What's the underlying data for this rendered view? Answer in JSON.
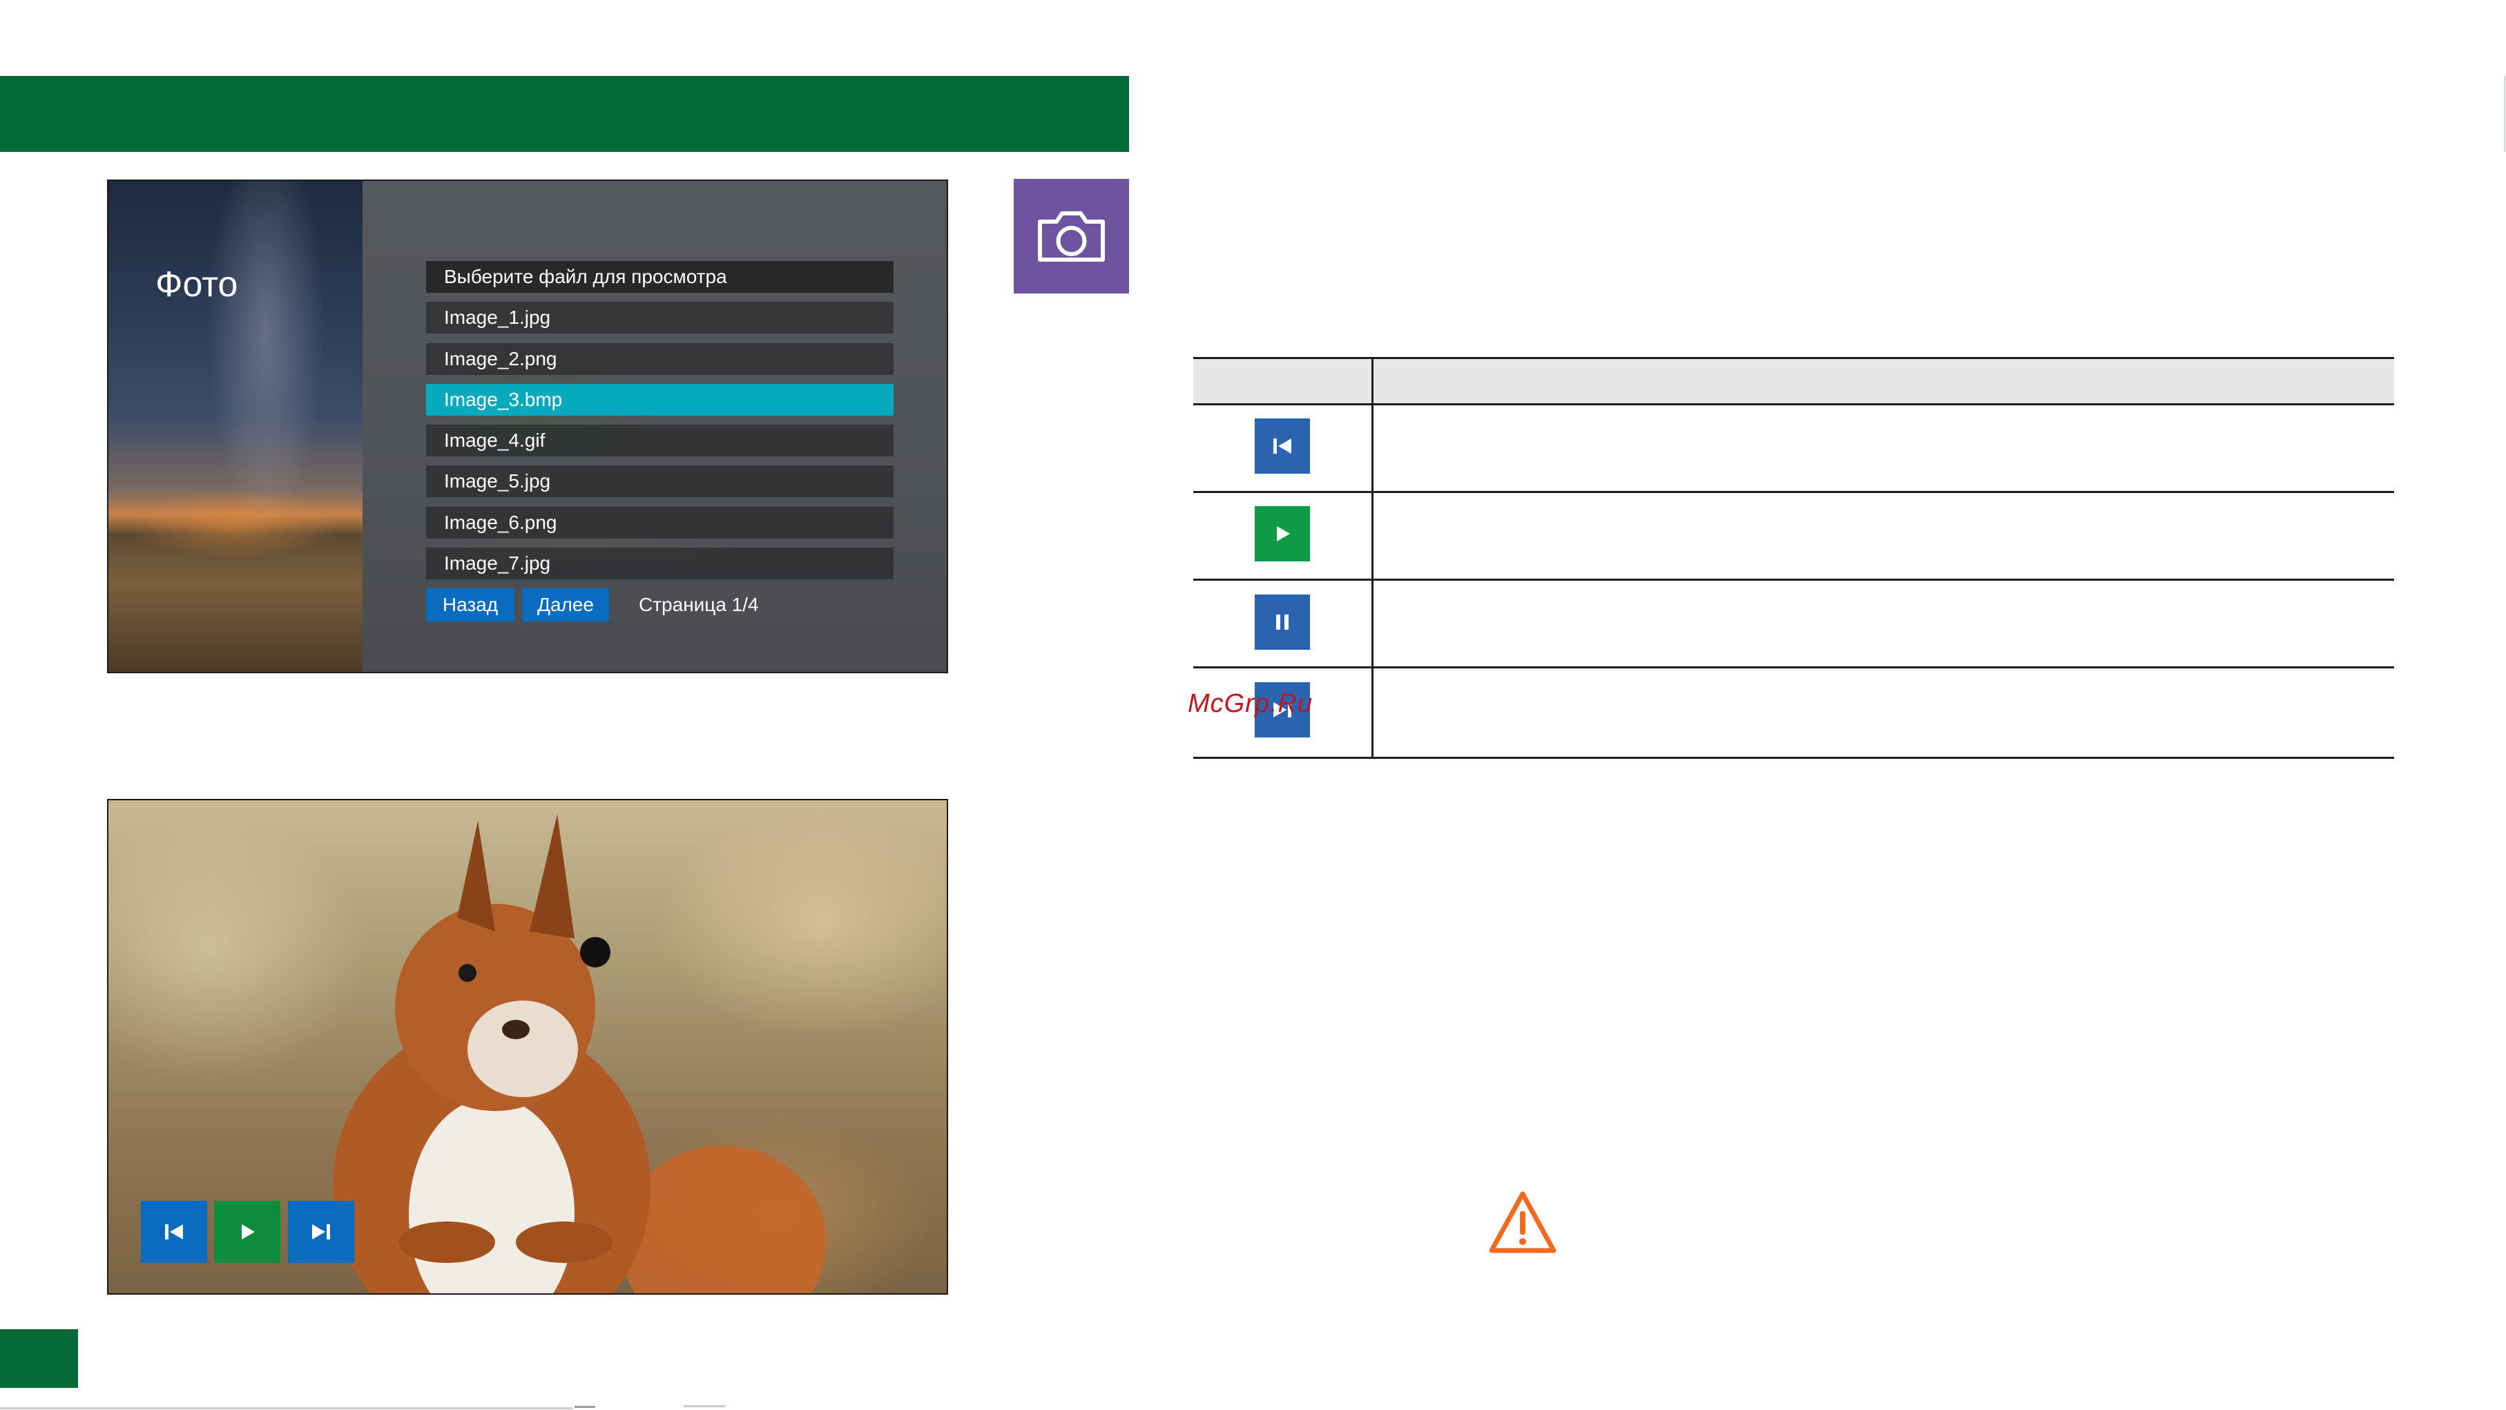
{
  "menu_screen": {
    "title": "Фото",
    "list_header": "Выберите файл для просмотра",
    "files": [
      "Image_1.jpg",
      "Image_2.png",
      "Image_3.bmp",
      "Image_4.gif",
      "Image_5.jpg",
      "Image_6.png",
      "Image_7.jpg"
    ],
    "selected_file": "Image_3.bmp",
    "back_button": "Назад",
    "next_button": "Далее",
    "page_indicator": "Страница 1/4"
  },
  "mode_icon": "camera-icon",
  "control_table": {
    "rows": [
      {
        "icon": "previous-icon",
        "color": "#2a64b1"
      },
      {
        "icon": "play-icon",
        "color": "#0f9a48"
      },
      {
        "icon": "pause-icon",
        "color": "#2a64b1"
      },
      {
        "icon": "next-icon",
        "color": "#2a64b1"
      }
    ]
  },
  "watermark": "McGrp.Ru",
  "viewer_controls": [
    {
      "icon": "previous-icon",
      "color": "#0a6cc1"
    },
    {
      "icon": "play-icon",
      "color": "#0f8c3c"
    },
    {
      "icon": "next-icon",
      "color": "#0a6cc1"
    }
  ],
  "warning_icon": "warning-icon",
  "colors": {
    "brand_green": "#026937",
    "selection_cyan": "#07a9bd",
    "camera_tile_purple": "#6d53a0",
    "warning_orange": "#f26a21"
  }
}
